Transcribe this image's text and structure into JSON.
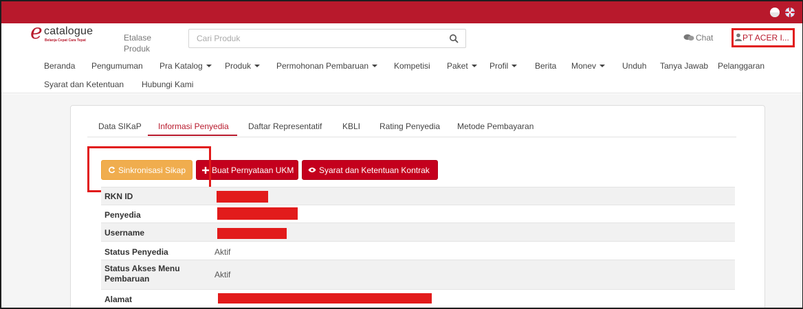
{
  "brand": {
    "logo_word": "catalogue",
    "logo_tagline": "Belanja Cepat Cara Tepat",
    "accent": "#b8192c"
  },
  "header": {
    "etalase_label": "Etalase Produk",
    "search_placeholder": "Cari Produk",
    "chat_label": "Chat",
    "account_label": "PT ACER I..."
  },
  "nav": {
    "items": [
      {
        "label": "Beranda"
      },
      {
        "label": "Pengumuman"
      },
      {
        "label": "Pra Katalog"
      },
      {
        "label": "Produk"
      },
      {
        "label": "Permohonan Pembaruan"
      },
      {
        "label": "Kompetisi"
      },
      {
        "label": "Paket"
      },
      {
        "label": "Profil"
      },
      {
        "label": "Berita"
      },
      {
        "label": "Monev"
      },
      {
        "label": "Unduh"
      },
      {
        "label": "Tanya Jawab"
      },
      {
        "label": "Pelanggaran"
      },
      {
        "label": "Syarat dan Ketentuan"
      },
      {
        "label": "Hubungi Kami"
      }
    ]
  },
  "tabs": [
    {
      "label": "Data SIKaP"
    },
    {
      "label": "Informasi Penyedia"
    },
    {
      "label": "Daftar Representatif"
    },
    {
      "label": "KBLI"
    },
    {
      "label": "Rating Penyedia"
    },
    {
      "label": "Metode Pembayaran"
    }
  ],
  "actions": {
    "sync_label": "Sinkronisasi Sikap",
    "ukm_label": "Buat Pernyataan UKM",
    "kontrak_label": "Syarat dan Ketentuan Kontrak"
  },
  "info": {
    "rows": [
      {
        "key": "RKN ID",
        "value": ""
      },
      {
        "key": "Penyedia",
        "value": ""
      },
      {
        "key": "Username",
        "value": ""
      },
      {
        "key": "Status Penyedia",
        "value": "Aktif"
      },
      {
        "key": "Status Akses Menu Pembaruan",
        "value": "Aktif"
      },
      {
        "key": "Alamat",
        "value": ""
      }
    ]
  }
}
